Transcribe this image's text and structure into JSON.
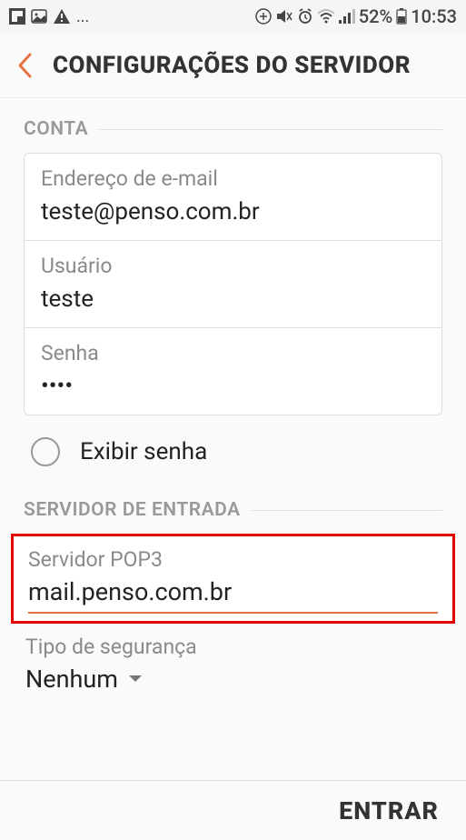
{
  "statusbar": {
    "battery": "52%",
    "time": "10:53"
  },
  "header": {
    "title": "CONFIGURAÇÕES DO SERVIDOR"
  },
  "account": {
    "section_title": "CONTA",
    "email_label": "Endereço de e-mail",
    "email_value": "teste@penso.com.br",
    "user_label": "Usuário",
    "user_value": "teste",
    "password_label": "Senha",
    "password_value": "••••",
    "show_password_label": "Exibir senha"
  },
  "incoming": {
    "section_title": "SERVIDOR DE ENTRADA",
    "pop_label": "Servidor POP3",
    "pop_value": "mail.penso.com.br",
    "security_label": "Tipo de segurança",
    "security_value": "Nenhum"
  },
  "footer": {
    "submit_label": "ENTRAR"
  }
}
